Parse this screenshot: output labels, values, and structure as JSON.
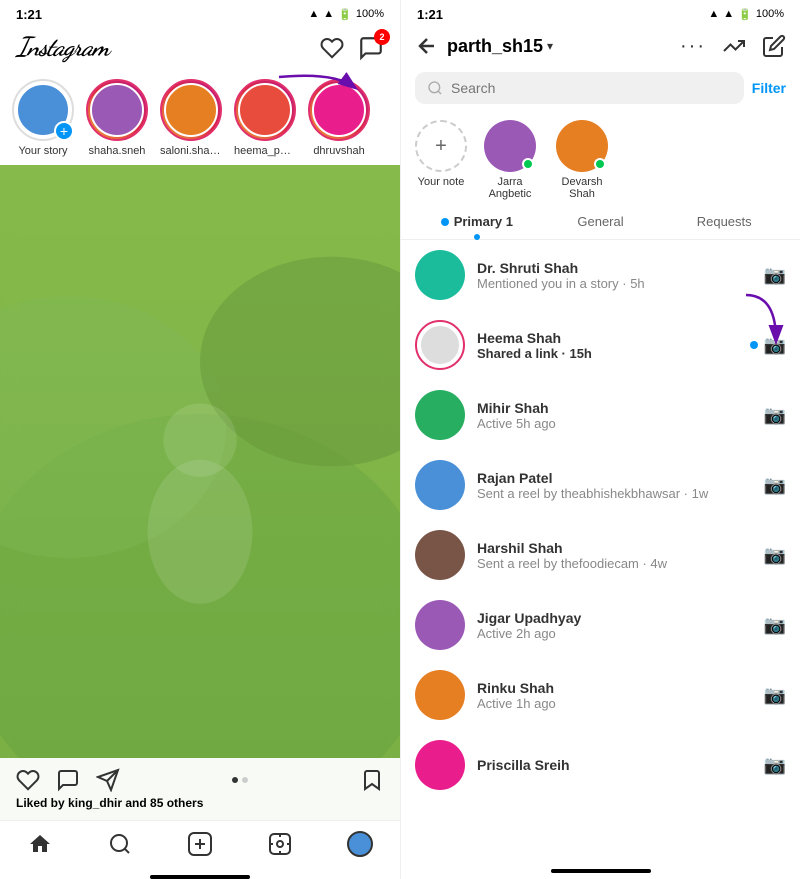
{
  "left": {
    "status": {
      "time": "1:21",
      "battery": "100%"
    },
    "header": {
      "logo": "Instagram",
      "messenger_badge": "2"
    },
    "stories": [
      {
        "id": "your-story",
        "label": "Your story",
        "has_ring": false,
        "has_add": true,
        "avatar_color": "av-blue"
      },
      {
        "id": "shaha",
        "label": "shaha.sneh",
        "has_ring": true,
        "has_add": false,
        "avatar_color": "av-purple"
      },
      {
        "id": "saloni",
        "label": "saloni.shah6...",
        "has_ring": true,
        "has_add": false,
        "avatar_color": "av-orange"
      },
      {
        "id": "heema",
        "label": "heema_parth...",
        "has_ring": true,
        "has_add": false,
        "avatar_color": "av-red"
      },
      {
        "id": "dhruv",
        "label": "dhruvshah",
        "has_ring": true,
        "has_add": false,
        "avatar_color": "av-pink"
      }
    ],
    "post": {
      "liked_by": "Liked by ",
      "liked_user": "king_dhir",
      "liked_others": " and 85 others"
    },
    "bottom_nav": [
      "home",
      "search",
      "add",
      "reels",
      "profile"
    ]
  },
  "right": {
    "status": {
      "time": "1:21",
      "battery": "100%"
    },
    "header": {
      "title": "parth_sh15",
      "chevron": "▾"
    },
    "search": {
      "placeholder": "Search"
    },
    "filter_label": "Filter",
    "notes": [
      {
        "id": "your-note",
        "label": "Your note",
        "has_avatar": false
      },
      {
        "id": "jarra",
        "label": "Jarra Angbetic",
        "has_avatar": true,
        "online": true,
        "color": "av-purple"
      },
      {
        "id": "devarsh",
        "label": "Devarsh Shah",
        "has_avatar": true,
        "online": true,
        "color": "av-orange"
      }
    ],
    "tabs": [
      {
        "id": "primary",
        "label": "Primary 1",
        "active": true
      },
      {
        "id": "general",
        "label": "General",
        "active": false
      },
      {
        "id": "requests",
        "label": "Requests",
        "active": false
      }
    ],
    "messages": [
      {
        "id": "msg-1",
        "name": "Dr. Shruti Shah",
        "preview": "Mentioned you in a story · 5h",
        "bold": false,
        "unread": false,
        "ring": false,
        "color": "av-teal"
      },
      {
        "id": "msg-2",
        "name": "Heema Shah",
        "preview": "Shared a link · 15h",
        "bold": true,
        "unread": true,
        "ring": true,
        "color": "av-red"
      },
      {
        "id": "msg-3",
        "name": "Mihir Shah",
        "preview": "Active 5h ago",
        "bold": false,
        "unread": false,
        "ring": false,
        "color": "av-green"
      },
      {
        "id": "msg-4",
        "name": "Rajan Patel",
        "preview": "Sent a reel by theabhishekbhawsar · 1w",
        "bold": false,
        "unread": false,
        "ring": false,
        "color": "av-blue"
      },
      {
        "id": "msg-5",
        "name": "Harshil Shah",
        "preview": "Sent a reel by thefoodiecam · 4w",
        "bold": false,
        "unread": false,
        "ring": false,
        "color": "av-brown"
      },
      {
        "id": "msg-6",
        "name": "Jigar Upadhyay",
        "preview": "Active 2h ago",
        "bold": false,
        "unread": false,
        "ring": false,
        "color": "av-purple"
      },
      {
        "id": "msg-7",
        "name": "Rinku Shah",
        "preview": "Active 1h ago",
        "bold": false,
        "unread": false,
        "ring": false,
        "color": "av-orange"
      },
      {
        "id": "msg-8",
        "name": "Priscilla Sreih",
        "preview": "",
        "bold": false,
        "unread": false,
        "ring": false,
        "color": "av-pink"
      }
    ]
  }
}
